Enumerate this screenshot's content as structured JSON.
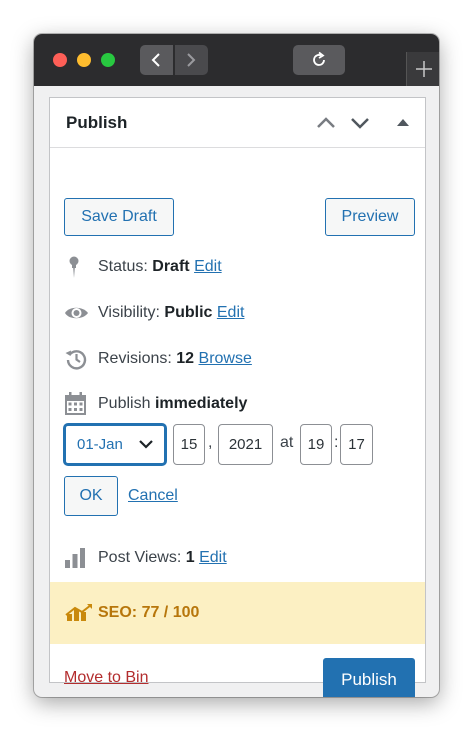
{
  "panel": {
    "title": "Publish",
    "header_controls": [
      "chevron-up-icon",
      "chevron-down-icon",
      "triangle-up-icon"
    ]
  },
  "actions": {
    "save_draft": "Save Draft",
    "preview": "Preview"
  },
  "status": {
    "label": "Status:",
    "value": "Draft",
    "edit": "Edit"
  },
  "visibility": {
    "label": "Visibility:",
    "value": "Public",
    "edit": "Edit"
  },
  "revisions": {
    "label": "Revisions:",
    "value": "12",
    "browse": "Browse"
  },
  "schedule": {
    "label": "Publish",
    "value": "immediately",
    "month": "01-Jan",
    "day": "15",
    "comma": ",",
    "year": "2021",
    "at": "at",
    "hour": "19",
    "colon": ":",
    "minute": "17",
    "ok": "OK",
    "cancel": "Cancel"
  },
  "views": {
    "label": "Post Views:",
    "value": "1",
    "edit": "Edit"
  },
  "seo": {
    "text": "SEO: 77 / 100"
  },
  "footer": {
    "move_to_bin": "Move to Bin",
    "publish": "Publish"
  },
  "colors": {
    "accent": "#2271b1",
    "danger": "#b32d2e",
    "seo_background": "#fcf0c3",
    "seo_text": "#b7760b",
    "icon_gray": "#8c8f94"
  }
}
